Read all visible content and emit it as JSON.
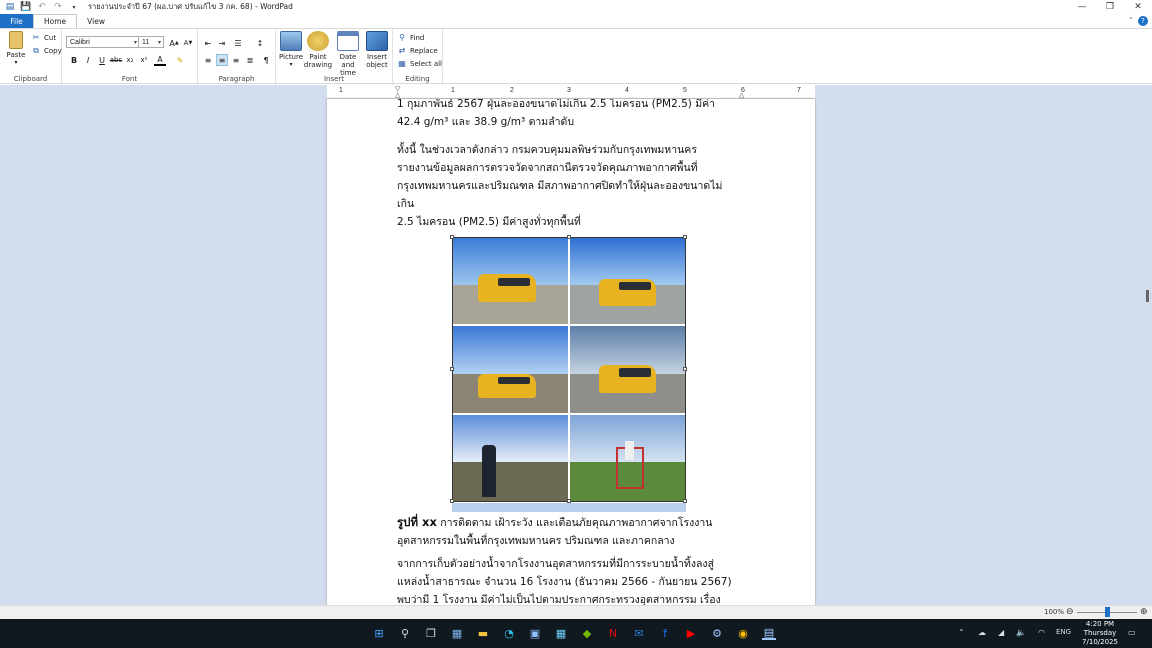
{
  "window": {
    "title": "รายงานประจำปี 67 (ผอ.บาศ ปรับแก้ไข 3 กค. 68) - WordPad"
  },
  "ribbon": {
    "tabs": [
      "File",
      "Home",
      "View"
    ],
    "clipboard": {
      "paste": "Paste",
      "cut": "Cut",
      "copy": "Copy",
      "label": "Clipboard"
    },
    "font": {
      "family": "Calibri",
      "size": "11",
      "label": "Font"
    },
    "paragraph": {
      "label": "Paragraph"
    },
    "insert": {
      "picture": "Picture",
      "paint": "Paint drawing",
      "paint_l1": "Paint",
      "paint_l2": "drawing",
      "datetime_l1": "Date and",
      "datetime_l2": "time",
      "object_l1": "Insert",
      "object_l2": "object",
      "label": "Insert"
    },
    "editing": {
      "find": "Find",
      "replace": "Replace",
      "select_all": "Select all",
      "label": "Editing"
    }
  },
  "ruler": {
    "numbers": [
      "1",
      "1",
      "2",
      "3",
      "4",
      "5",
      "6",
      "7"
    ]
  },
  "document": {
    "line_top": "1 กุมภาพันธ์ 2567 ฝุ่นละอองขนาดไม่เกิน 2.5 ไมครอน (PM2.5) มีค่า",
    "line_values": "42.4 g/m³ และ 38.9 g/m³ ตามลำดับ",
    "para2": [
      "ทั้งนี้      ในช่วงเวลาดังกล่าว      กรมควบคุมมลพิษร่วมกับกรุงเทพมหานคร",
      "รายงานข้อมูลผลการตรวจวัดจากสถานีตรวจวัดคุณภาพอากาศพื้นที่",
      "กรุงเทพมหานครและปริมณฑล    มีสภาพอากาศปิดทำให้ฝุ่นละอองขนาดไม่",
      "เกิน",
      "2.5 ไมครอน (PM2.5) มีค่าสูงทั่วทุกพื้นที่"
    ],
    "caption_bold": "รูปที่ xx",
    "caption_text": " การติดตาม เฝ้าระวัง และเตือนภัยคุณภาพอากาศจากโรงงาน",
    "caption_line2": "อุตสาหกรรมในพื้นที่กรุงเทพมหานคร ปริมณฑล และภาคกลาง",
    "para3": [
      "จากการเก็บตัวอย่างน้ำจากโรงงานอุตสาหกรรมที่มีการระบายน้ำทิ้งลงสู่",
      "แหล่งน้ำสาธารณะ จำนวน 16 โรงงาน (ธันวาคม 2566 - กันยายน 2567)",
      "พบว่ามี  1  โรงงาน  มีค่าไม่เป็นไปตามประกาศกระทรวงอุตสาหกรรม  เรื่อง"
    ]
  },
  "statusbar": {
    "zoom": "100%"
  },
  "taskbar": {
    "lang": "ENG",
    "time": "4:20 PM",
    "day": "Thursday",
    "date": "7/10/2025"
  },
  "colors": {
    "accent": "#1e6fc7",
    "doc_bg": "#d2ddee",
    "van": "#e8b321",
    "taskbar": "#101820"
  }
}
